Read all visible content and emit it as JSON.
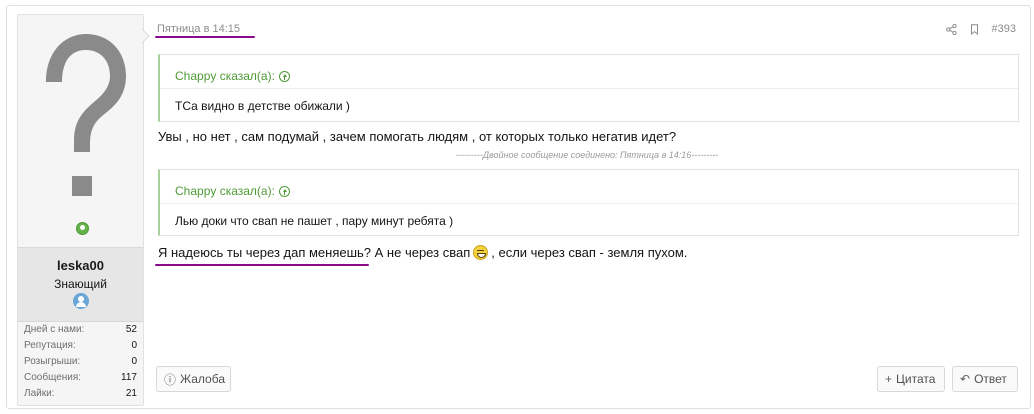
{
  "post": {
    "date": "Пятница в 14:15",
    "number": "#393",
    "icons": {
      "share": "share-icon",
      "bookmark": "bookmark-icon"
    }
  },
  "user": {
    "avatar_icon": "question-mark-avatar",
    "username": "leska00",
    "title": "Знающий",
    "stats": [
      {
        "label": "Дней с нами:",
        "value": "52"
      },
      {
        "label": "Репутация:",
        "value": "0"
      },
      {
        "label": "Розыгрыши:",
        "value": "0"
      },
      {
        "label": "Сообщения:",
        "value": "117"
      },
      {
        "label": "Лайки:",
        "value": "21"
      }
    ]
  },
  "content": {
    "quote1": {
      "author": "Chappy сказал(а):",
      "text": "ТСа видно в детстве обижали )"
    },
    "line1": "Увы , но нет , сам подумай , зачем помогать людям , от которых только негатив идет?",
    "merge_note": "---------Двойное сообщение соединено: Пятница в 14:16---------",
    "quote2": {
      "author": "Chappy сказал(а):",
      "text": "Лью доки что свап не пашет , пару минут ребята )"
    },
    "line2_a": "Я надеюсь ты через дап меняешь? А не через свап",
    "line2_b": ", если через свап - земля пухом."
  },
  "actions": {
    "report": "Жалоба",
    "quote": "Цитата",
    "reply": "Ответ"
  },
  "colors": {
    "accent_green": "#4f9a35",
    "annotation_purple": "#8b0a8b",
    "border": "#dfdfdf"
  }
}
